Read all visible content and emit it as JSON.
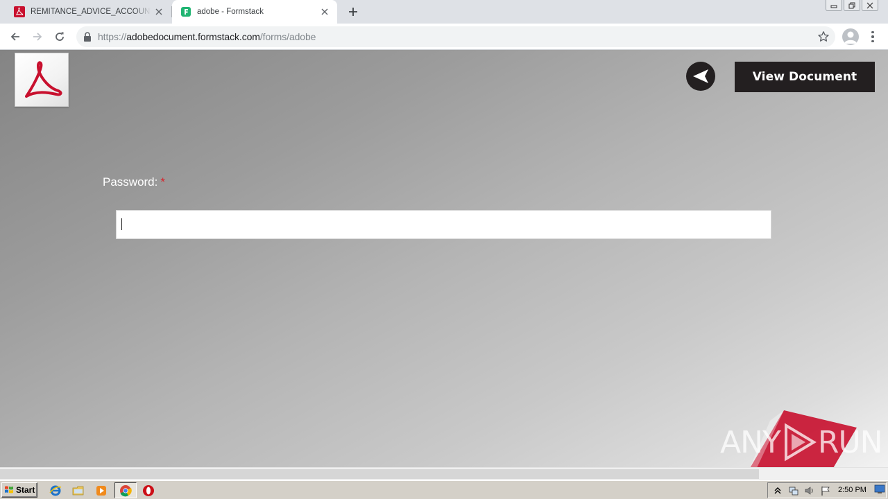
{
  "browser": {
    "tabs": [
      {
        "title": "REMITANCE_ADVICE_ACCOUNTING",
        "favicon": "pdf-icon",
        "active": false
      },
      {
        "title": "adobe - Formstack",
        "favicon": "formstack-icon",
        "active": true
      }
    ],
    "address": {
      "scheme": "https://",
      "host": "adobedocument.formstack.com",
      "path": "/forms/adobe"
    }
  },
  "page": {
    "view_document_label": "View Document",
    "password_label": "Password:",
    "required_marker": "*",
    "password_value": "",
    "watermark_left": "ANY",
    "watermark_right": "RUN"
  },
  "taskbar": {
    "start_label": "Start",
    "clock": "2:50 PM"
  },
  "colors": {
    "tab_strip": "#dee1e6",
    "dark_button": "#231f20",
    "required_red": "#d8222a",
    "adobe_red": "#c8102e"
  }
}
